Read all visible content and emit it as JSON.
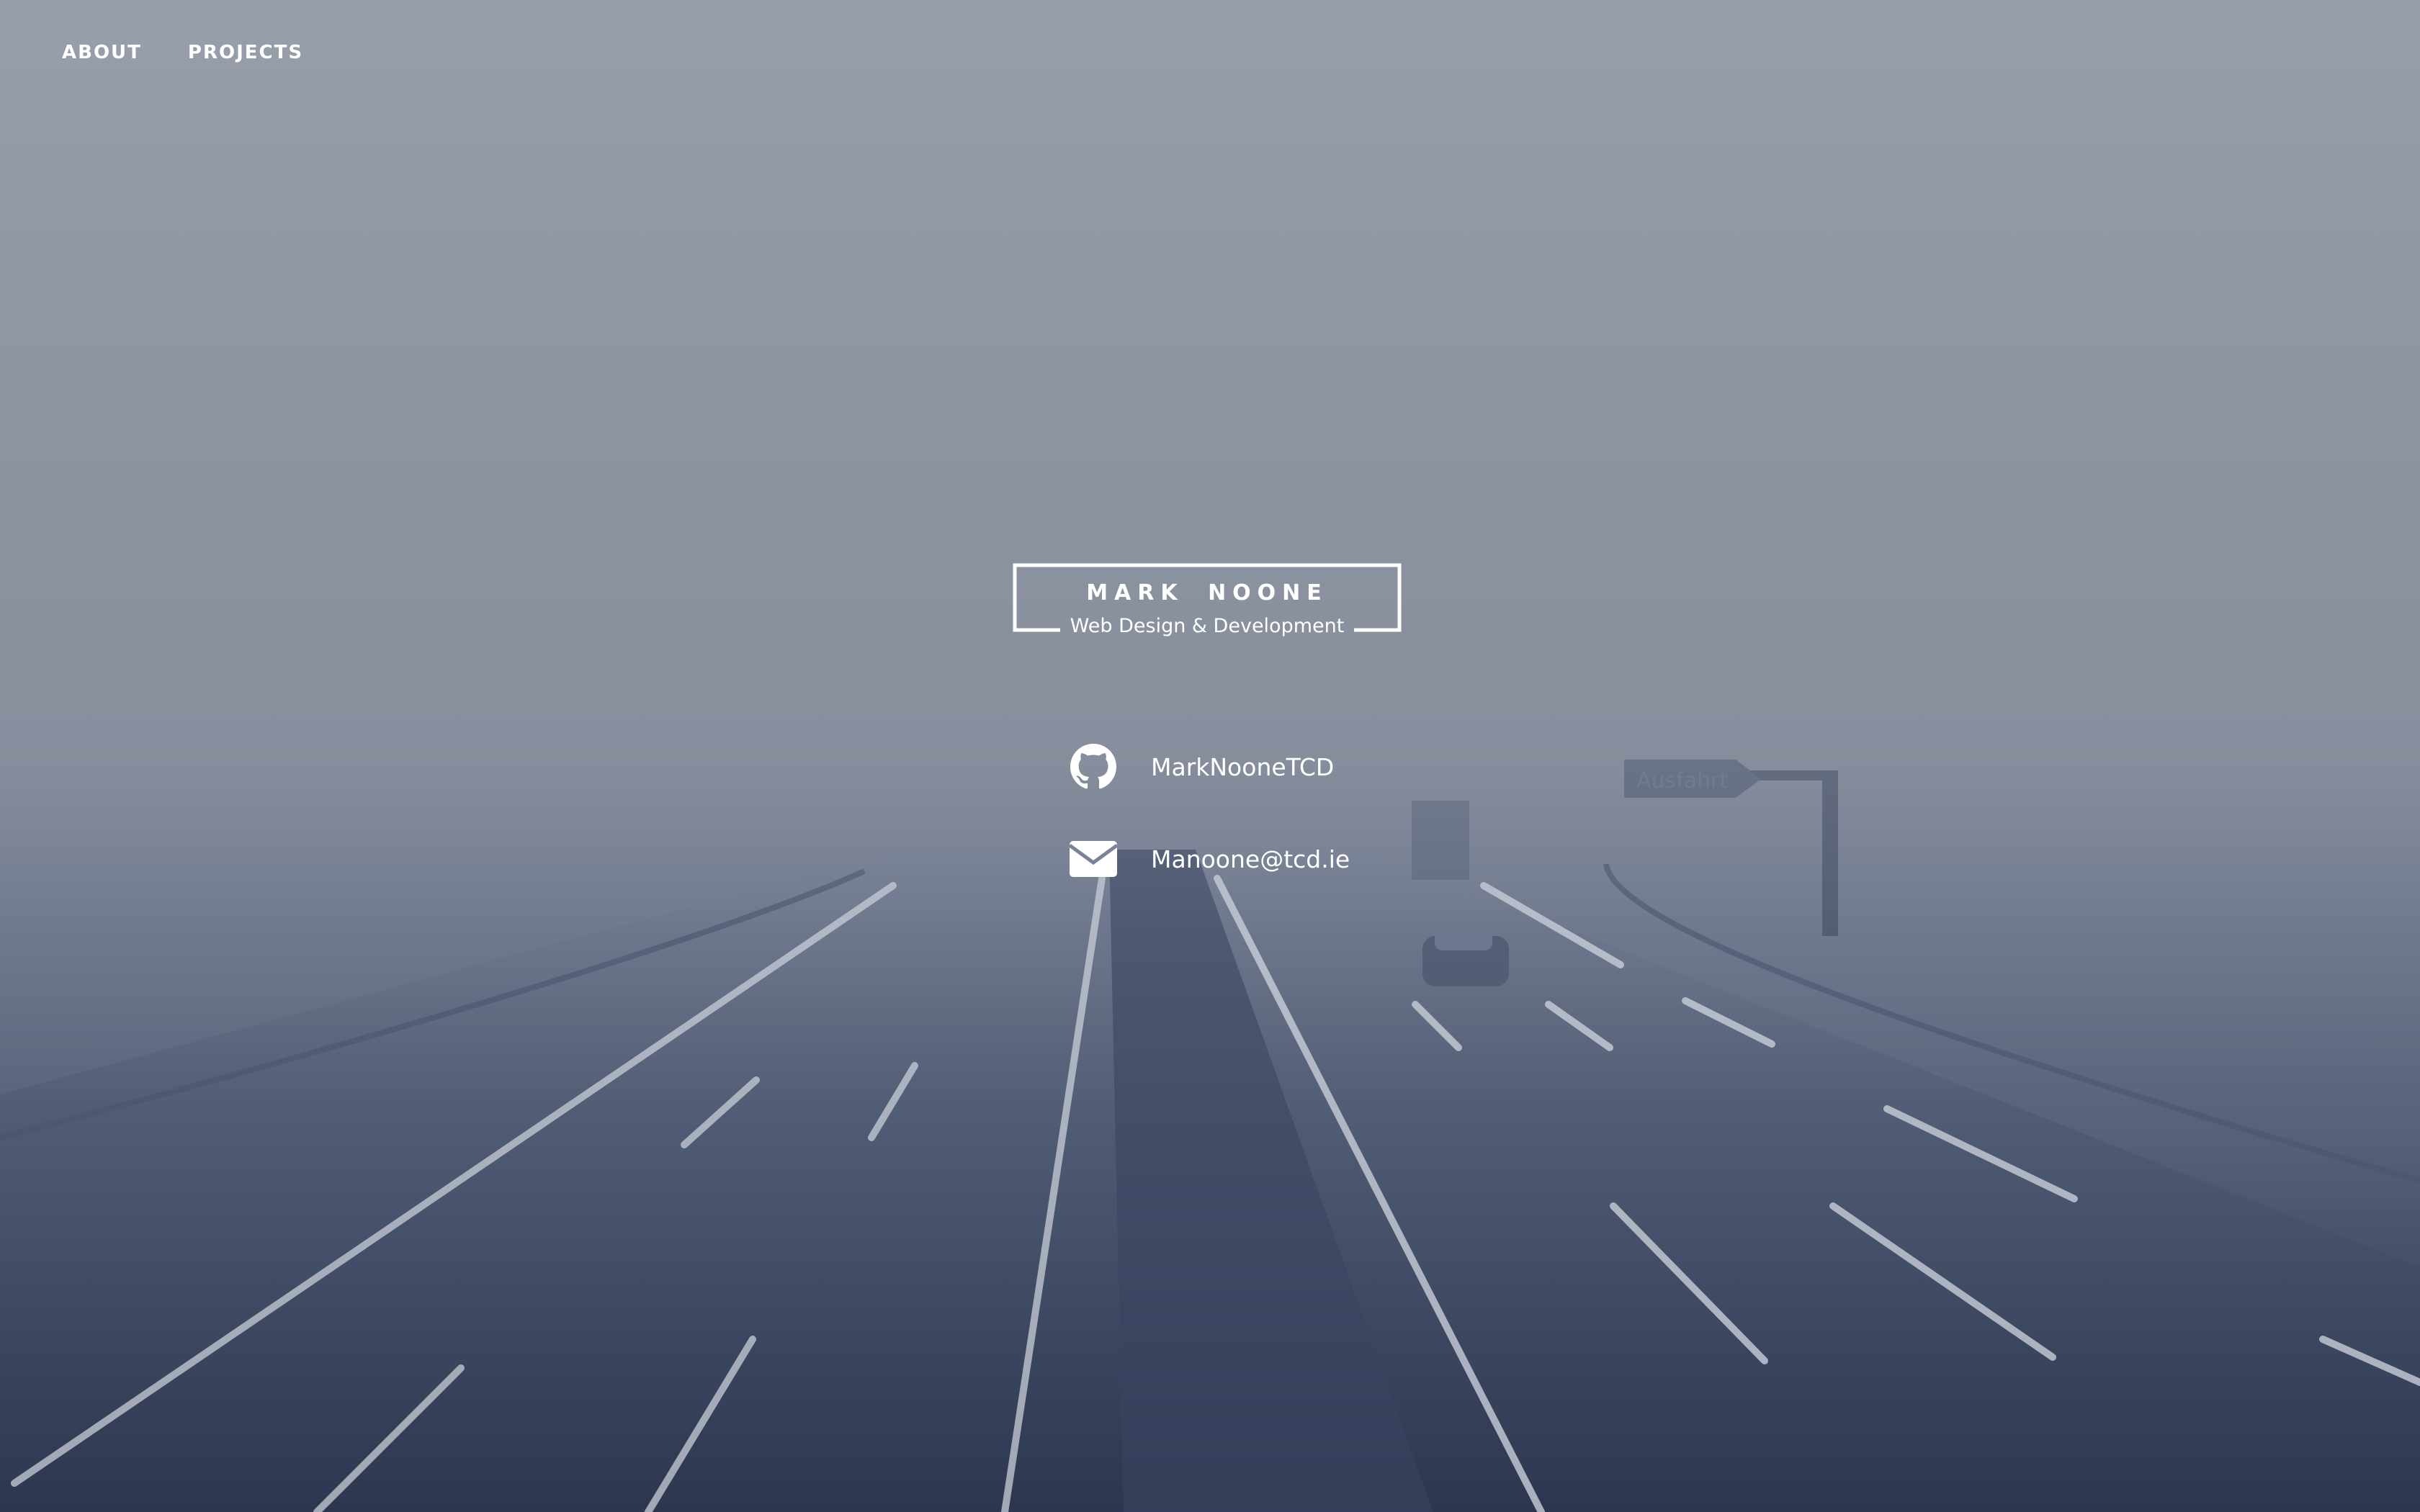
{
  "nav": {
    "items": [
      {
        "label": "ABOUT"
      },
      {
        "label": "PROJECTS"
      }
    ]
  },
  "logo": {
    "name": "MARK NOONE",
    "subtitle": "Web Design & Development"
  },
  "contacts": [
    {
      "icon": "github-icon",
      "label": "MarkNooneTCD"
    },
    {
      "icon": "envelope-icon",
      "label": "Manoone@tcd.ie"
    }
  ],
  "background": {
    "description_icon": "foggy-highway-photo",
    "sign_text": "Ausfahrt"
  }
}
